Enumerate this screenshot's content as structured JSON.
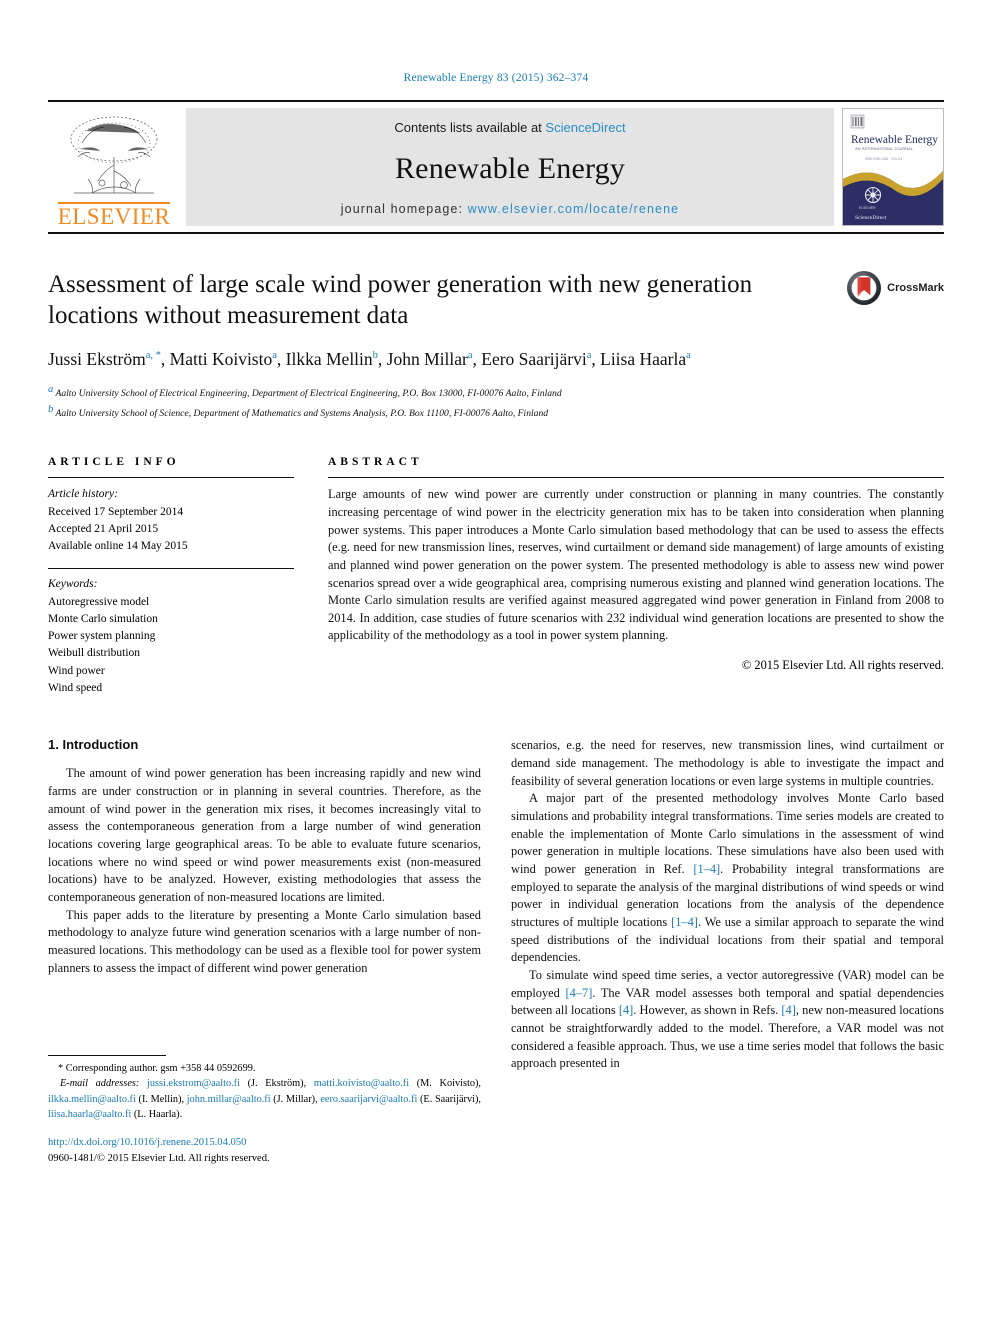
{
  "running_head": "Renewable Energy 83 (2015) 362–374",
  "masthead": {
    "publisher_name": "ELSEVIER",
    "contents_prefix": "Contents lists available at",
    "contents_link": "ScienceDirect",
    "journal_title": "Renewable Energy",
    "homepage_prefix": "journal homepage:",
    "homepage_url": "www.elsevier.com/locate/renene",
    "cover": {
      "title": "Renewable Energy",
      "subtitle": "AN INTERNATIONAL JOURNAL",
      "tagline": "ISSN 0960-1481",
      "footer": "ScienceDirect"
    }
  },
  "article": {
    "title": "Assessment of large scale wind power generation with new generation locations without measurement data",
    "authors": [
      {
        "name": "Jussi Ekström",
        "sup": "a, *"
      },
      {
        "name": "Matti Koivisto",
        "sup": "a"
      },
      {
        "name": "Ilkka Mellin",
        "sup": "b"
      },
      {
        "name": "John Millar",
        "sup": "a"
      },
      {
        "name": "Eero Saarijärvi",
        "sup": "a"
      },
      {
        "name": "Liisa Haarla",
        "sup": "a"
      }
    ],
    "affiliations": [
      {
        "marker": "a",
        "text": "Aalto University School of Electrical Engineering, Department of Electrical Engineering, P.O. Box 13000, FI-00076 Aalto, Finland"
      },
      {
        "marker": "b",
        "text": "Aalto University School of Science, Department of Mathematics and Systems Analysis, P.O. Box 11100, FI-00076 Aalto, Finland"
      }
    ],
    "crossmark_label": "CrossMark"
  },
  "article_info": {
    "heading": "ARTICLE INFO",
    "history_label": "Article history:",
    "history": [
      "Received 17 September 2014",
      "Accepted 21 April 2015",
      "Available online 14 May 2015"
    ],
    "keywords_label": "Keywords:",
    "keywords": [
      "Autoregressive model",
      "Monte Carlo simulation",
      "Power system planning",
      "Weibull distribution",
      "Wind power",
      "Wind speed"
    ]
  },
  "abstract": {
    "heading": "ABSTRACT",
    "text": "Large amounts of new wind power are currently under construction or planning in many countries. The constantly increasing percentage of wind power in the electricity generation mix has to be taken into consideration when planning power systems. This paper introduces a Monte Carlo simulation based methodology that can be used to assess the effects (e.g. need for new transmission lines, reserves, wind curtailment or demand side management) of large amounts of existing and planned wind power generation on the power system. The presented methodology is able to assess new wind power scenarios spread over a wide geographical area, comprising numerous existing and planned wind generation locations. The Monte Carlo simulation results are verified against measured aggregated wind power generation in Finland from 2008 to 2014. In addition, case studies of future scenarios with 232 individual wind generation locations are presented to show the applicability of the methodology as a tool in power system planning.",
    "copyright": "© 2015 Elsevier Ltd. All rights reserved."
  },
  "introduction": {
    "section_number": "1.",
    "section_title": "Introduction",
    "left_paragraphs": [
      "The amount of wind power generation has been increasing rapidly and new wind farms are under construction or in planning in several countries. Therefore, as the amount of wind power in the generation mix rises, it becomes increasingly vital to assess the contemporaneous generation from a large number of wind generation locations covering large geographical areas. To be able to evaluate future scenarios, locations where no wind speed or wind power measurements exist (non-measured locations) have to be analyzed. However, existing methodologies that assess the contemporaneous generation of non-measured locations are limited.",
      "This paper adds to the literature by presenting a Monte Carlo simulation based methodology to analyze future wind generation scenarios with a large number of non-measured locations. This methodology can be used as a flexible tool for power system planners to assess the impact of different wind power generation"
    ],
    "right_paragraph_1_continuation": "scenarios, e.g. the need for reserves, new transmission lines, wind curtailment or demand side management. The methodology is able to investigate the impact and feasibility of several generation locations or even large systems in multiple countries.",
    "right_paragraph_2": {
      "part1": "A major part of the presented methodology involves Monte Carlo based simulations and probability integral transformations. Time series models are created to enable the implementation of Monte Carlo simulations in the assessment of wind power generation in multiple locations. These simulations have also been used with wind power generation in Ref. ",
      "cite1": "[1–4]",
      "part2": ". Probability integral transformations are employed to separate the analysis of the marginal distributions of wind speeds or wind power in individual generation locations from the analysis of the dependence structures of multiple locations ",
      "cite2": "[1–4]",
      "part3": ". We use a similar approach to separate the wind speed distributions of the individual locations from their spatial and temporal dependencies."
    },
    "right_paragraph_3": {
      "part1": "To simulate wind speed time series, a vector autoregressive (VAR) model can be employed ",
      "cite1": "[4–7]",
      "part2": ". The VAR model assesses both temporal and spatial dependencies between all locations ",
      "cite2": "[4]",
      "part3": ". However, as shown in Refs. ",
      "cite3": "[4]",
      "part4": ", new non-measured locations cannot be straightforwardly added to the model. Therefore, a VAR model was not considered a feasible approach. Thus, we use a time series model that follows the basic approach presented in"
    }
  },
  "footnotes": {
    "corresponding": "* Corresponding author. gsm +358 44 0592699.",
    "email_label": "E-mail addresses:",
    "emails": [
      {
        "address": "jussi.ekstrom@aalto.fi",
        "owner": "(J. Ekström)"
      },
      {
        "address": "matti.koivisto@aalto.fi",
        "owner": "(M. Koivisto)"
      },
      {
        "address": "ilkka.mellin@aalto.fi",
        "owner": "(I. Mellin)"
      },
      {
        "address": "john.millar@aalto.fi",
        "owner": "(J. Millar)"
      },
      {
        "address": "eero.saarijarvi@aalto.fi",
        "owner": "(E. Saarijärvi)"
      },
      {
        "address": "liisa.haarla@aalto.fi",
        "owner": "(L. Haarla)"
      }
    ],
    "doi": "http://dx.doi.org/10.1016/j.renene.2015.04.050",
    "issn_line": "0960-1481/© 2015 Elsevier Ltd. All rights reserved."
  },
  "colors": {
    "link_blue": "#1a7bb5",
    "elsevier_orange": "#f08a1e",
    "masthead_gray": "#e4e4e4",
    "crossmark_red": "#d2342b"
  }
}
